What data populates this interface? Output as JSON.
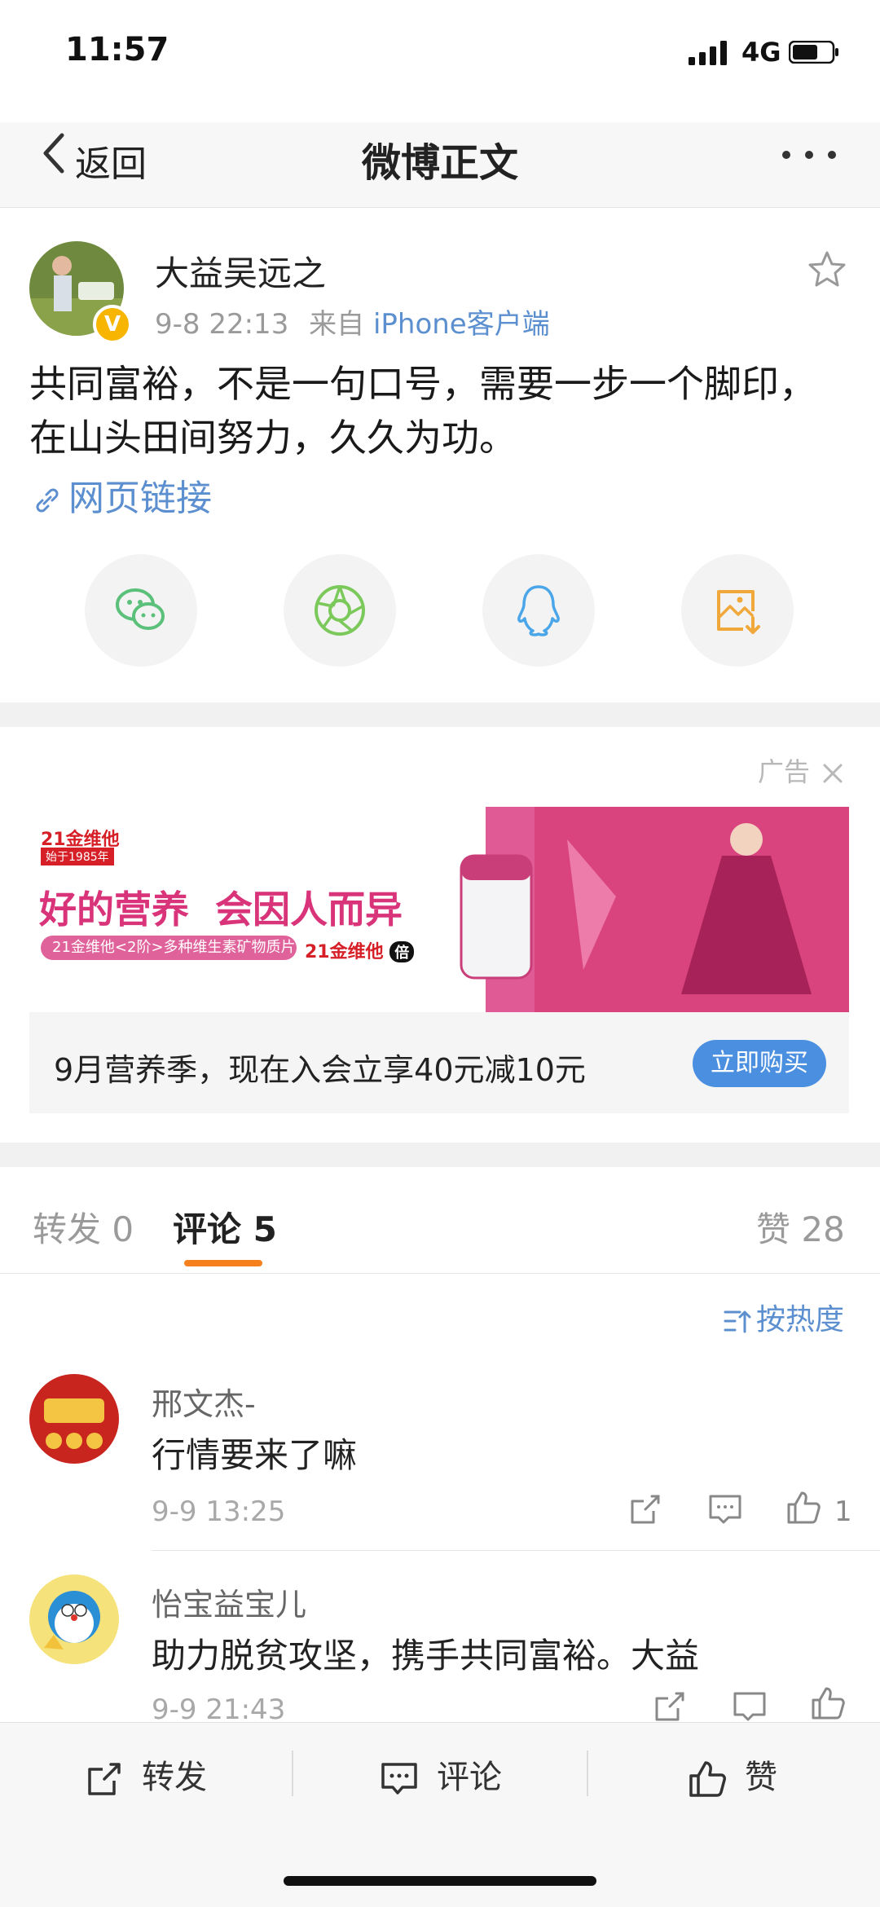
{
  "status_bar": {
    "time": "11:57",
    "network": "4G"
  },
  "nav": {
    "back_label": "返回",
    "title": "微博正文",
    "more_icon": "more-icon"
  },
  "post": {
    "author": "大益吴远之",
    "verified_mark": "V",
    "time": "9-8 22:13",
    "source_prefix": "来自",
    "source": "iPhone客户端",
    "text": "共同富裕，不是一句口号，需要一步一个脚印，在山头田间努力，久久为功。",
    "link_text": "网页链接"
  },
  "share": [
    {
      "icon": "wechat-icon",
      "color": "#5bc07a"
    },
    {
      "icon": "moments-icon",
      "color": "#7bc95a"
    },
    {
      "icon": "qq-icon",
      "color": "#4aa6e8"
    },
    {
      "icon": "save-image-icon",
      "color": "#f0a83a"
    }
  ],
  "ad": {
    "tag": "广告",
    "brand": "21金维他",
    "since": "始于1985年",
    "headline": "好的营养  会因人而异",
    "product_line": "21金维他<2阶>多种维生素矿物质片",
    "brand_mark": "21金维他",
    "brand_mark_badge": "倍",
    "footer_text": "9月营养季，现在入会立享40元减10元",
    "button": "立即购买"
  },
  "tabs": {
    "repost": "转发 0",
    "comment": "评论 5",
    "like": "赞 28",
    "sort": "按热度"
  },
  "comments": [
    {
      "name": "邢文杰-",
      "text": "行情要来了嘛",
      "time": "9-9 13:25",
      "likes": "1"
    },
    {
      "name": "怡宝益宝儿",
      "text": "助力脱贫攻坚，携手共同富裕。大益",
      "time": "9-9 21:43",
      "likes": ""
    }
  ],
  "bottom_bar": {
    "repost": "转发",
    "comment": "评论",
    "like": "赞"
  },
  "colors": {
    "accent_link": "#5c8fcf",
    "tab_underline": "#f7801e",
    "buy_button": "#4a8fe0",
    "verified": "#f7b500"
  }
}
